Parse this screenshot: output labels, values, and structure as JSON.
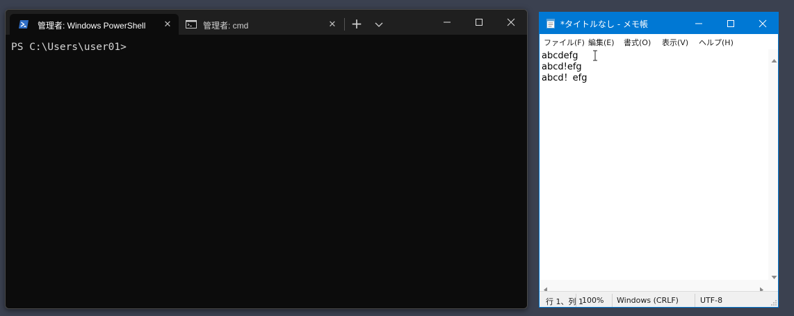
{
  "terminal": {
    "tabs": [
      {
        "label": "管理者: Windows PowerShell",
        "icon": "powershell-icon",
        "active": true
      },
      {
        "label": "管理者: cmd",
        "icon": "cmd-icon",
        "active": false
      }
    ],
    "close_glyph": "✕",
    "new_tab_glyph": "+",
    "prompt": "PS C:\\Users\\user01>",
    "colors": {
      "background": "#0c0c0c",
      "titlebar": "#1f1f1f",
      "text": "#d6d6d6"
    }
  },
  "notepad": {
    "title": "*タイトルなし - メモ帳",
    "menu": [
      "ファイル(F)",
      "編集(E)",
      "書式(O)",
      "表示(V)",
      "ヘルプ(H)"
    ],
    "lines": [
      "abcdefg",
      "abcd!efg",
      "abcd！efg"
    ],
    "status": {
      "position": "行 1、列 1",
      "zoom": "100%",
      "line_ending": "Windows (CRLF)",
      "encoding": "UTF-8"
    },
    "colors": {
      "titlebar": "#0078d4",
      "accent": "#0078d4"
    }
  }
}
